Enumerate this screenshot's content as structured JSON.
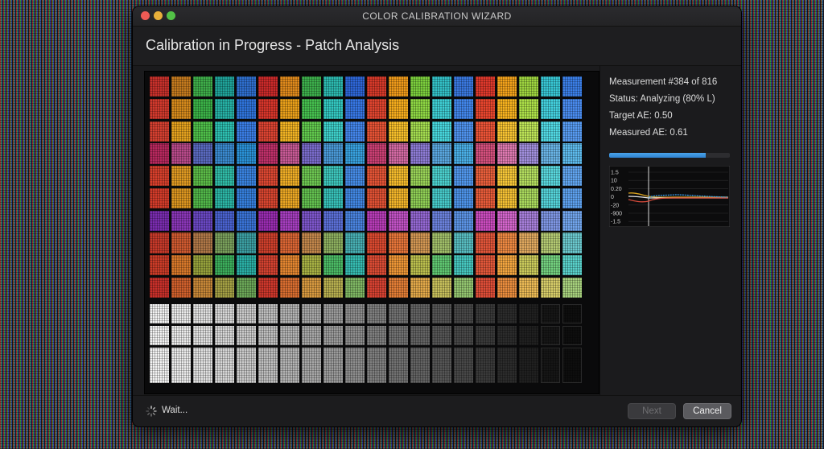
{
  "window": {
    "title": "COLOR CALIBRATION WIZARD",
    "header": "Calibration in Progress - Patch Analysis"
  },
  "status": {
    "measurement": "Measurement #384 of 816",
    "status_text": "Status: Analyzing (80% L)",
    "target": "Target AE: 0.50",
    "measured": "Measured AE: 0.61",
    "progress_fraction": 0.8
  },
  "graph": {
    "y_labels": [
      "1.5",
      "10",
      "0.20",
      "0",
      "-20",
      "-900",
      "-1.5"
    ],
    "series_colors": [
      "#d8a21e",
      "#e4e4e4",
      "#d44a3a",
      "#3aa0ea"
    ]
  },
  "footer": {
    "wait": "Wait...",
    "next_label": "Next",
    "cancel_label": "Cancel"
  },
  "patches": {
    "color_rows": [
      [
        "#c8312b",
        "#c47a1e",
        "#3fae4a",
        "#1fa39a",
        "#2f6fcf",
        "#cc2a2a",
        "#e08a1c",
        "#3db04c",
        "#2cbab0",
        "#2e66d8",
        "#d83a2a",
        "#ef9a1a",
        "#7ccf3d",
        "#33c1c8",
        "#3a78e0",
        "#e0392c",
        "#f3a21b",
        "#9fd640",
        "#38c8d6",
        "#3b7fe8"
      ],
      [
        "#d33a2d",
        "#d68a1c",
        "#3bb348",
        "#26b2a6",
        "#2f74dc",
        "#d9362b",
        "#eaa01a",
        "#46c14f",
        "#33c9c2",
        "#3777e5",
        "#e2452f",
        "#f6ad1d",
        "#8fd844",
        "#3fd0d6",
        "#4287ec",
        "#ea462e",
        "#f8b31f",
        "#aee249",
        "#44d2e0",
        "#4a8cf0"
      ],
      [
        "#d64030",
        "#e5a21e",
        "#4fc04a",
        "#2dc0b2",
        "#3a7ee6",
        "#de4432",
        "#f3b423",
        "#62cb4e",
        "#3ed1cc",
        "#4486ec",
        "#e85335",
        "#f8c02a",
        "#a5de50",
        "#48d8df",
        "#4f93ef",
        "#ee5437",
        "#fac532",
        "#bfe658",
        "#52dbe6",
        "#589cf4"
      ],
      [
        "#b8285e",
        "#b84a8a",
        "#5a6ac0",
        "#3a8ad0",
        "#2a92d8",
        "#c0306a",
        "#c85a96",
        "#7a6ccc",
        "#4a9ad8",
        "#38a2e0",
        "#cc4074",
        "#d46aa4",
        "#8e7cd6",
        "#5aa8e0",
        "#4ab0e8",
        "#d6507e",
        "#e07ab2",
        "#a290de",
        "#6ab6e8",
        "#5ebcef"
      ],
      [
        "#d8402c",
        "#e09a22",
        "#5cbc48",
        "#30bca8",
        "#3a84e2",
        "#de4832",
        "#f0ae26",
        "#6ec852",
        "#3ec8be",
        "#468ce8",
        "#e65536",
        "#f6bc2c",
        "#9ad458",
        "#4cd2d0",
        "#5298ee",
        "#ec603c",
        "#f8c838",
        "#b6e060",
        "#5adae0",
        "#62a6f2"
      ],
      [
        "#d43c2a",
        "#dc9620",
        "#52b84a",
        "#2cb6a6",
        "#3680de",
        "#da4630",
        "#eca824",
        "#64c250",
        "#38c2ba",
        "#4288e4",
        "#e25234",
        "#f4b62a",
        "#90d056",
        "#48cccc",
        "#4e94ea",
        "#ea5c3a",
        "#f6c234",
        "#acdc5e",
        "#56d6dc",
        "#5ea2f0"
      ],
      [
        "#7a2cb0",
        "#8a36b8",
        "#6a48c4",
        "#4a62d0",
        "#3a74d8",
        "#9a2cb2",
        "#a63ec0",
        "#7e56cc",
        "#5c70d8",
        "#4a84e0",
        "#b83cb8",
        "#c252c6",
        "#9468d4",
        "#6c82de",
        "#5c94e6",
        "#cc4cc0",
        "#d666ce",
        "#a880dc",
        "#8098e6",
        "#72a6ee"
      ],
      [
        "#c83a2a",
        "#d05a30",
        "#b07848",
        "#7aa05c",
        "#3ca0a4",
        "#d0402c",
        "#dc6634",
        "#c4884c",
        "#8eb060",
        "#48b0b4",
        "#dc4a30",
        "#e8763a",
        "#d49854",
        "#a2c06a",
        "#58bec2",
        "#e4563a",
        "#f08a42",
        "#e2aa60",
        "#b6cc74",
        "#6ccad0"
      ],
      [
        "#cc3c28",
        "#d8782a",
        "#96a23c",
        "#3cae5c",
        "#2ab0a6",
        "#d44230",
        "#e48630",
        "#a8b244",
        "#4cbc66",
        "#36bcb2",
        "#dc4c34",
        "#ee9636",
        "#bcc04e",
        "#60c872",
        "#46c8c0",
        "#e4583a",
        "#f4a640",
        "#cccc5c",
        "#74d280",
        "#5ad2cc"
      ],
      [
        "#c8302a",
        "#d0602c",
        "#c88838",
        "#a4a044",
        "#6ca858",
        "#d0382c",
        "#da6e30",
        "#d89a40",
        "#b8b050",
        "#80b864",
        "#d84232",
        "#e47e36",
        "#e4aa4a",
        "#c8c05c",
        "#94c670",
        "#e04e38",
        "#ec8e3e",
        "#eebc56",
        "#d8ce6a",
        "#a8d27e"
      ]
    ],
    "gray_row_colors": [
      "#f4f4f4",
      "#ececec",
      "#e2e2e2",
      "#d8d8d8",
      "#cccccc",
      "#c0c0c0",
      "#b4b4b4",
      "#a8a8a8",
      "#9c9c9c",
      "#8e8e8e",
      "#808080",
      "#727272",
      "#646464",
      "#565656",
      "#484848",
      "#3a3a3a",
      "#2c2c2c",
      "#202020",
      "#161616",
      "#0e0e0e"
    ]
  }
}
